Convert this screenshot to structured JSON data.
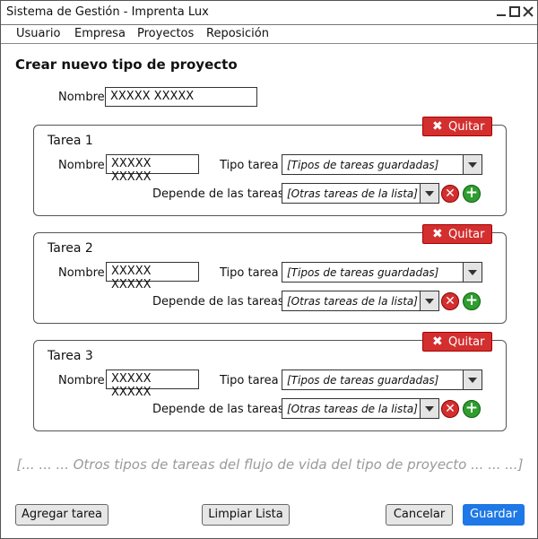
{
  "window": {
    "title": "Sistema de Gestión - Imprenta Lux"
  },
  "menu": [
    "Usuario",
    "Empresa",
    "Proyectos",
    "Reposición"
  ],
  "form": {
    "heading": "Crear nuevo tipo de proyecto",
    "nombre_label": "Nombre",
    "nombre_value": "XXXXX XXXXX"
  },
  "tasks": [
    {
      "title": "Tarea 1",
      "remove_label": "Quitar",
      "nombre_label": "Nombre",
      "nombre_value": "XXXXX XXXXX",
      "tipo_label": "Tipo tarea",
      "tipo_value": "[Tipos de tareas guardadas]",
      "depende_label": "Depende de las tareas",
      "depende_value": "[Otras tareas de la lista]"
    },
    {
      "title": "Tarea 2",
      "remove_label": "Quitar",
      "nombre_label": "Nombre",
      "nombre_value": "XXXXX XXXXX",
      "tipo_label": "Tipo tarea",
      "tipo_value": "[Tipos de tareas guardadas]",
      "depende_label": "Depende de las tareas",
      "depende_value": "[Otras tareas de la lista]"
    },
    {
      "title": "Tarea 3",
      "remove_label": "Quitar",
      "nombre_label": "Nombre",
      "nombre_value": "XXXXX XXXXX",
      "tipo_label": "Tipo tarea",
      "tipo_value": "[Tipos de tareas guardadas]",
      "depende_label": "Depende de las tareas",
      "depende_value": "[Otras tareas de la lista]"
    }
  ],
  "hint": "[... ... ... Otros tipos de tareas del flujo de vida del tipo de proyecto ... ... ...]",
  "buttons": {
    "add": "Agregar tarea",
    "clear": "Limpiar Lista",
    "cancel": "Cancelar",
    "save": "Guardar"
  },
  "icons": {
    "remove": "x-icon",
    "remove_dependency": "remove-circle-icon",
    "add_dependency": "add-circle-icon",
    "dropdown": "chevron-down-icon"
  },
  "colors": {
    "danger": "#d32f2f",
    "success": "#2e9e2e",
    "primary": "#1e78e6"
  }
}
